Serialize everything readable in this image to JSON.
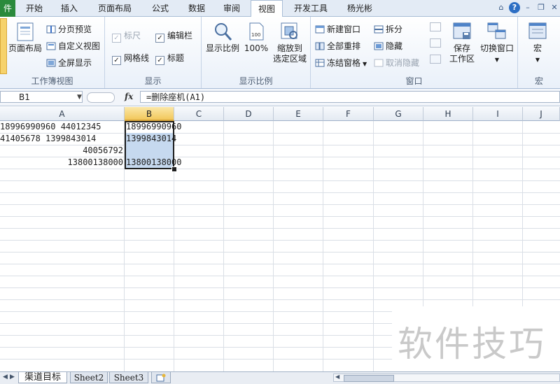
{
  "tabs": {
    "file": "件",
    "items": [
      "开始",
      "插入",
      "页面布局",
      "公式",
      "数据",
      "审阅",
      "视图",
      "开发工具",
      "杨光彬"
    ],
    "active": "视图"
  },
  "ribbon": {
    "workbook_views": {
      "label": "工作簿视图",
      "page_layout": "页面布局",
      "page_break_preview": "分页预览",
      "custom_views": "自定义视图",
      "full_screen": "全屏显示"
    },
    "show": {
      "label": "显示",
      "ruler": "标尺",
      "formula_bar": "编辑栏",
      "gridlines": "网格线",
      "headings": "标题"
    },
    "zoom": {
      "label": "显示比例",
      "zoom": "显示比例",
      "hundred": "100%",
      "zoom_selection_1": "缩放到",
      "zoom_selection_2": "选定区域"
    },
    "window": {
      "label": "窗口",
      "new_window": "新建窗口",
      "arrange_all": "全部重排",
      "freeze_panes": "冻结窗格",
      "split": "拆分",
      "hide": "隐藏",
      "unhide": "取消隐藏",
      "save_workspace_1": "保存",
      "save_workspace_2": "工作区",
      "switch_windows": "切换窗口"
    },
    "macros": {
      "label": "宏",
      "macros": "宏"
    }
  },
  "formula_bar": {
    "name_box": "B1",
    "fx": "fx",
    "formula": "=删除座机(A1)"
  },
  "columns": [
    "A",
    "B",
    "C",
    "D",
    "E",
    "F",
    "G",
    "H",
    "I",
    "J"
  ],
  "cells": {
    "A1": "18996990960 44012345",
    "A2": "41405678 1399843014",
    "A3": "40056792",
    "A4": "13800138000",
    "B1": "18996990960",
    "B2": "1399843014",
    "B4": "13800138000"
  },
  "sheets": [
    "渠道目标",
    "Sheet2",
    "Sheet3"
  ],
  "active_sheet": "渠道目标",
  "watermark": "软件技巧"
}
